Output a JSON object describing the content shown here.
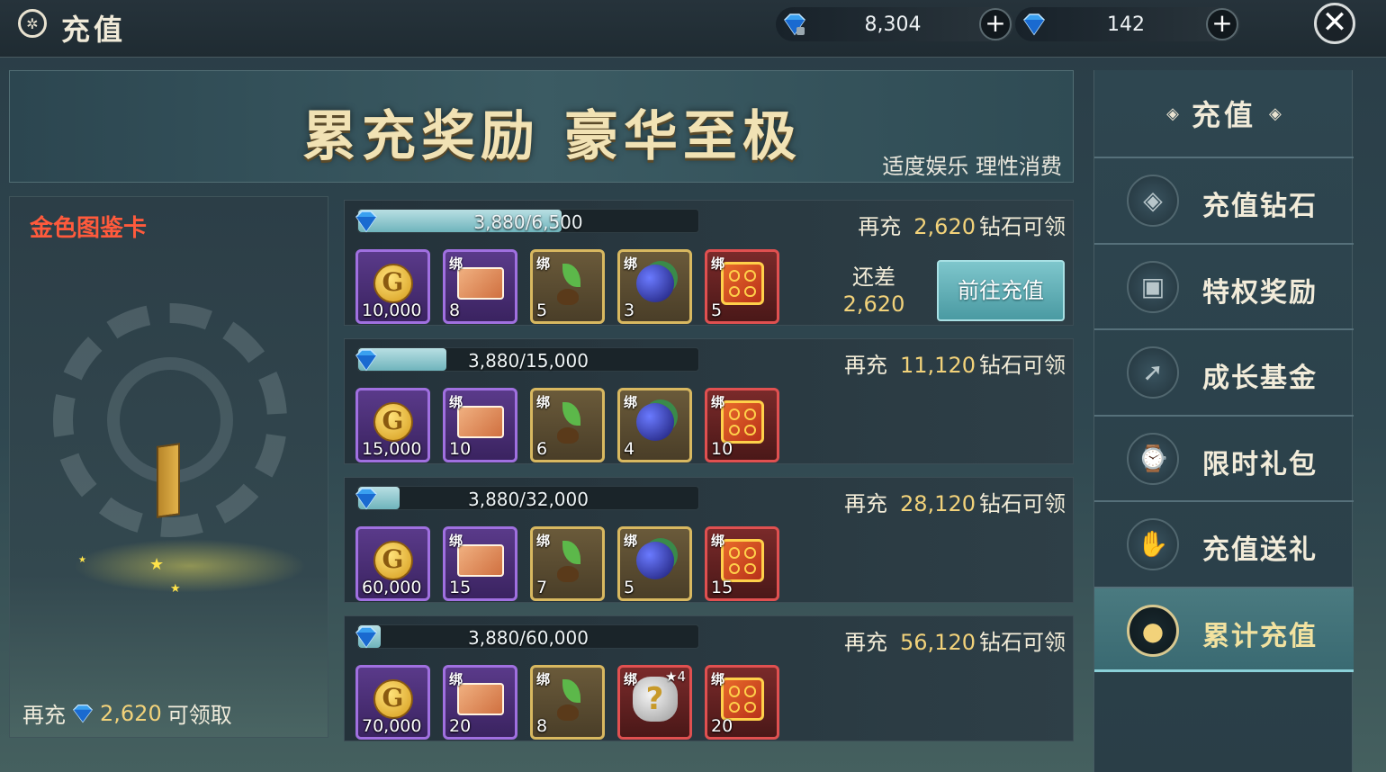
{
  "header": {
    "title": "充值",
    "currencies": [
      {
        "icon": "bound-diamond-icon",
        "value": "8,304"
      },
      {
        "icon": "diamond-icon",
        "value": "142"
      }
    ],
    "plus_label": "+",
    "close_label": "✕"
  },
  "banner": {
    "title": "累充奖励 豪华至极",
    "subtitle": "适度娱乐 理性消费"
  },
  "preview": {
    "title": "金色图鉴卡",
    "footer_prefix": "再充",
    "footer_amount": "2,620",
    "footer_suffix": "可领取"
  },
  "tiers": [
    {
      "progress_text": "3,880/6,500",
      "progress": 0.597,
      "need_prefix": "再充",
      "need_amount": "2,620",
      "need_suffix": "钻石可领",
      "items": [
        {
          "type": "coin",
          "rarity": "purple",
          "bind": "",
          "qty": "10,000"
        },
        {
          "type": "ticket",
          "rarity": "purple",
          "bind": "绑",
          "qty": "8"
        },
        {
          "type": "sprout",
          "rarity": "gold",
          "bind": "绑",
          "qty": "5"
        },
        {
          "type": "berry",
          "rarity": "gold",
          "bind": "绑",
          "qty": "3"
        },
        {
          "type": "dice",
          "rarity": "red",
          "bind": "绑",
          "qty": "5"
        }
      ],
      "remain_label": "还差",
      "remain_value": "2,620",
      "button_label": "前往充值"
    },
    {
      "progress_text": "3,880/15,000",
      "progress": 0.259,
      "need_prefix": "再充",
      "need_amount": "11,120",
      "need_suffix": "钻石可领",
      "items": [
        {
          "type": "coin",
          "rarity": "purple",
          "bind": "",
          "qty": "15,000"
        },
        {
          "type": "ticket",
          "rarity": "purple",
          "bind": "绑",
          "qty": "10"
        },
        {
          "type": "sprout",
          "rarity": "gold",
          "bind": "绑",
          "qty": "6"
        },
        {
          "type": "berry",
          "rarity": "gold",
          "bind": "绑",
          "qty": "4"
        },
        {
          "type": "dice",
          "rarity": "red",
          "bind": "绑",
          "qty": "10"
        }
      ]
    },
    {
      "progress_text": "3,880/32,000",
      "progress": 0.121,
      "need_prefix": "再充",
      "need_amount": "28,120",
      "need_suffix": "钻石可领",
      "items": [
        {
          "type": "coin",
          "rarity": "purple",
          "bind": "",
          "qty": "60,000"
        },
        {
          "type": "ticket",
          "rarity": "purple",
          "bind": "绑",
          "qty": "15"
        },
        {
          "type": "sprout",
          "rarity": "gold",
          "bind": "绑",
          "qty": "7"
        },
        {
          "type": "berry",
          "rarity": "gold",
          "bind": "绑",
          "qty": "5"
        },
        {
          "type": "dice",
          "rarity": "red",
          "bind": "绑",
          "qty": "15"
        }
      ]
    },
    {
      "progress_text": "3,880/60,000",
      "progress": 0.065,
      "need_prefix": "再充",
      "need_amount": "56,120",
      "need_suffix": "钻石可领",
      "items": [
        {
          "type": "coin",
          "rarity": "purple",
          "bind": "",
          "qty": "70,000"
        },
        {
          "type": "ticket",
          "rarity": "purple",
          "bind": "绑",
          "qty": "20"
        },
        {
          "type": "sprout",
          "rarity": "gold",
          "bind": "绑",
          "qty": "8"
        },
        {
          "type": "mystery",
          "rarity": "red",
          "bind": "绑",
          "qty": "",
          "stars": "★4"
        },
        {
          "type": "dice",
          "rarity": "red",
          "bind": "绑",
          "qty": "20"
        }
      ]
    }
  ],
  "nav": {
    "title": "充值",
    "items": [
      {
        "label": "充值钻石",
        "icon": "diamond-icon",
        "glyph": "◈",
        "active": false
      },
      {
        "label": "特权奖励",
        "icon": "treasure-chest-icon",
        "glyph": "▣",
        "active": false
      },
      {
        "label": "成长基金",
        "icon": "growth-arrow-icon",
        "glyph": "➚",
        "active": false
      },
      {
        "label": "限时礼包",
        "icon": "gift-clock-icon",
        "glyph": "⌚",
        "active": false
      },
      {
        "label": "充值送礼",
        "icon": "gift-hand-icon",
        "glyph": "✋",
        "active": false
      },
      {
        "label": "累计充值",
        "icon": "piggy-bank-icon",
        "glyph": "●",
        "active": true
      }
    ]
  },
  "colors": {
    "accent_gold": "#f2d27a",
    "preview_title": "#ff5a3c",
    "button_teal": "#5aaab2"
  }
}
